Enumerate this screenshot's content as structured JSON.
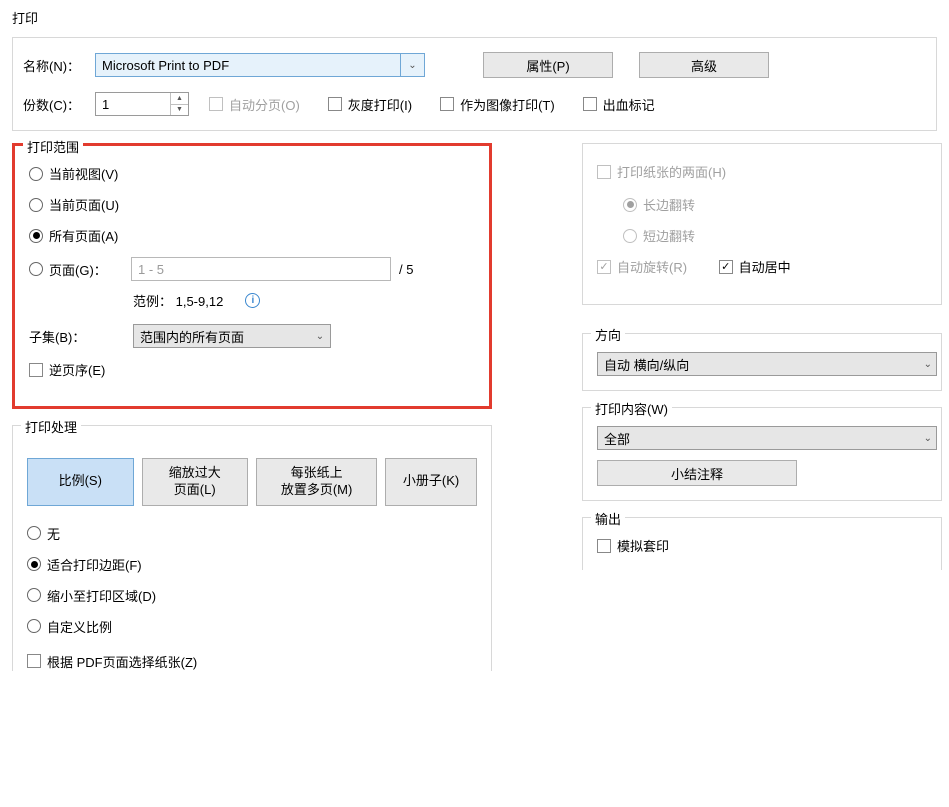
{
  "title": "打印",
  "top": {
    "name_label": "名称(N)：",
    "printer": "Microsoft Print to PDF",
    "properties_btn": "属性(P)",
    "advanced_btn": "高级",
    "copies_label": "份数(C)：",
    "copies_value": "1",
    "collate": "自动分页(O)",
    "grayscale": "灰度打印(I)",
    "as_image": "作为图像打印(T)",
    "bleed": "出血标记"
  },
  "range": {
    "legend": "打印范围",
    "current_view": "当前视图(V)",
    "current_page": "当前页面(U)",
    "all_pages": "所有页面(A)",
    "pages": "页面(G)：",
    "pages_placeholder": "1 - 5",
    "total": "/ 5",
    "example": "范例： 1,5-9,12",
    "subset_label": "子集(B)：",
    "subset_value": "范围内的所有页面",
    "reverse": "逆页序(E)"
  },
  "duplex": {
    "both_sides": "打印纸张的两面(H)",
    "long_edge": "长边翻转",
    "short_edge": "短边翻转",
    "auto_rotate": "自动旋转(R)",
    "auto_center": "自动居中"
  },
  "handling": {
    "legend": "打印处理",
    "tab_scale": "比例(S)",
    "tab_shrink": "缩放过大\n页面(L)",
    "tab_multi": "每张纸上\n放置多页(M)",
    "tab_booklet": "小册子(K)",
    "opt_none": "无",
    "opt_fit": "适合打印边距(F)",
    "opt_shrink_area": "缩小至打印区域(D)",
    "opt_custom": "自定义比例",
    "choose_paper": "根据 PDF页面选择纸张(Z)"
  },
  "orientation": {
    "legend": "方向",
    "value": "自动 横向/纵向"
  },
  "content": {
    "legend": "打印内容(W)",
    "value": "全部",
    "summary_btn": "小结注释"
  },
  "output": {
    "legend": "输出",
    "simulate": "模拟套印"
  }
}
